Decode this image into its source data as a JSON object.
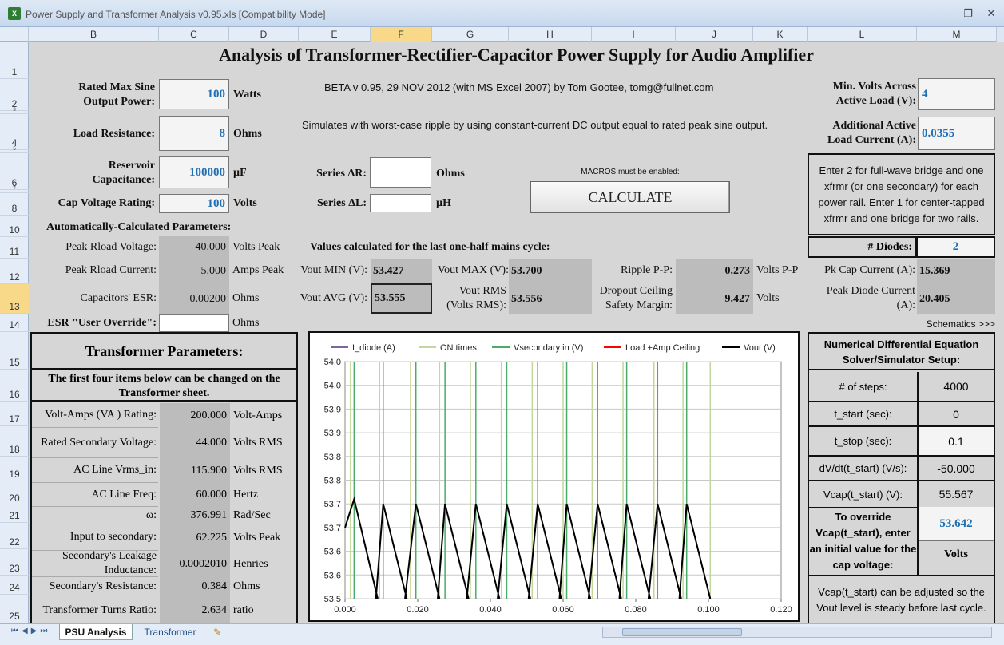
{
  "window": {
    "title": "Power Supply and Transformer Analysis v0.95.xls  [Compatibility Mode]",
    "icon": "excel-icon"
  },
  "columns": [
    "B",
    "C",
    "D",
    "E",
    "F",
    "G",
    "H",
    "I",
    "J",
    "K",
    "L",
    "M"
  ],
  "selected_column": "F",
  "rows": [
    "1",
    "2",
    "3",
    "4",
    "5",
    "6",
    "7",
    "8",
    "10",
    "11",
    "12",
    "13",
    "14",
    "15",
    "16",
    "17",
    "18",
    "19",
    "20",
    "21",
    "22",
    "23",
    "24",
    "25"
  ],
  "selected_row": "13",
  "sheet": {
    "title": "Analysis of Transformer-Rectifier-Capacitor Power Supply for Audio Amplifier",
    "beta": "BETA v 0.95, 29 NOV 2012 (with MS Excel 2007) by Tom Gootee, tomg@fullnet.com",
    "simulates": "Simulates with worst-case ripple by using constant-current DC output equal to rated peak sine output.",
    "macros_note": "MACROS must be enabled:",
    "calculate_label": "CALCULATE",
    "rated_power": {
      "label": "Rated Max Sine Output Power:",
      "value": "100",
      "unit": "Watts"
    },
    "load_resistance": {
      "label": "Load Resistance:",
      "value": "8",
      "unit": "Ohms"
    },
    "reservoir": {
      "label": "Reservoir Capacitance:",
      "value": "100000",
      "unit": "µF"
    },
    "cap_voltage": {
      "label": "Cap Voltage Rating:",
      "value": "100",
      "unit": "Volts"
    },
    "series_r": {
      "label": "Series ΔR:",
      "unit": "Ohms"
    },
    "series_l": {
      "label": "Series ΔL:",
      "unit": "µH"
    },
    "min_volts": {
      "label": "Min. Volts Across Active Load (V):",
      "value": "4"
    },
    "add_current": {
      "label": "Additional Active Load Current  (A):",
      "value": "0.0355"
    },
    "diode_note": "Enter 2 for full-wave bridge and one xfrmr (or one secondary) for each power rail. Enter 1 for center-tapped xfrmr and one bridge for two rails.",
    "diodes": {
      "label": "# Diodes:",
      "value": "2"
    },
    "auto_header": "Automatically-Calculated Parameters:",
    "peak_rload_v": {
      "label": "Peak Rload Voltage:",
      "value": "40.000",
      "unit": "Volts Peak"
    },
    "peak_rload_i": {
      "label": "Peak Rload Current:",
      "value": "5.000",
      "unit": "Amps Peak"
    },
    "esr": {
      "label": "Capacitors' ESR:",
      "value": "0.00200",
      "unit": "Ohms"
    },
    "esr_override": {
      "label": "ESR \"User Override\":",
      "unit": "Ohms"
    },
    "values_header": "Values calculated for the last one-half mains cycle:",
    "vout_min": {
      "label": "Vout MIN (V):",
      "value": "53.427"
    },
    "vout_max": {
      "label": "Vout MAX (V):",
      "value": "53.700"
    },
    "ripple": {
      "label": "Ripple P-P:",
      "value": "0.273",
      "unit": "Volts P-P"
    },
    "vout_avg": {
      "label": "Vout AVG (V):",
      "value": "53.555"
    },
    "vout_rms": {
      "label": "Vout RMS (Volts RMS):",
      "value": "53.556"
    },
    "dropout": {
      "label": "Dropout Ceiling Safety Margin:",
      "value": "9.427",
      "unit": "Volts"
    },
    "pk_cap": {
      "label": "Pk Cap Current (A):",
      "value": "15.369"
    },
    "peak_diode": {
      "label": "Peak Diode Current (A):",
      "value": "20.405"
    },
    "schematics": "Schematics >>>"
  },
  "transformer": {
    "title": "Transformer Parameters:",
    "note": "The first four items below can be changed  on the Transformer sheet.",
    "rows": [
      {
        "label": "Volt-Amps (VA ) Rating:",
        "value": "200.000",
        "unit": "Volt-Amps"
      },
      {
        "label": "Rated Secondary Voltage:",
        "value": "44.000",
        "unit": "Volts RMS"
      },
      {
        "label": "AC Line Vrms_in:",
        "value": "115.900",
        "unit": "Volts RMS"
      },
      {
        "label": "AC Line Freq:",
        "value": "60.000",
        "unit": "Hertz"
      },
      {
        "label": "ω:",
        "value": "376.991",
        "unit": "Rad/Sec"
      },
      {
        "label": "Input to secondary:",
        "value": "62.225",
        "unit": "Volts Peak"
      },
      {
        "label": "Secondary's Leakage Inductance:",
        "value": "0.0002010",
        "unit": "Henries"
      },
      {
        "label": "Secondary's Resistance:",
        "value": "0.384",
        "unit": "Ohms"
      },
      {
        "label": "Transformer Turns Ratio:",
        "value": "2.634",
        "unit": "ratio"
      }
    ]
  },
  "solver": {
    "title": "Numerical Differential Equation Solver/Simulator Setup:",
    "rows": [
      {
        "label": "# of steps:",
        "value": "4000"
      },
      {
        "label": "t_start (sec):",
        "value": "0"
      },
      {
        "label": "t_stop (sec):",
        "value": "0.1"
      },
      {
        "label": "dV/dt(t_start) (V/s):",
        "value": "-50.000"
      },
      {
        "label": "Vcap(t_start) (V):",
        "value": "55.567"
      }
    ],
    "override_label": "To override Vcap(t_start), enter an initial value for the cap voltage:",
    "override_value": "53.642",
    "override_unit": "Volts",
    "footer": "Vcap(t_start) can be adjusted so the Vout level is steady before last cycle."
  },
  "tabs": [
    "PSU Analysis",
    "Transformer"
  ],
  "colors": {
    "i_diode": "#8064a2",
    "on_times": "#c3d69b",
    "vsecondary": "#4bac6a",
    "load": "#ff0000",
    "vout": "#000000"
  },
  "chart_data": {
    "type": "line",
    "legend": [
      "I_diode (A)",
      "ON times",
      "Vsecondary in (V)",
      "Load +Amp Ceiling",
      "Vout (V)"
    ],
    "legend_position": "top",
    "xlim": [
      0,
      0.12
    ],
    "ylim": [
      53.5,
      54.0
    ],
    "xticks": [
      "0.000",
      "0.020",
      "0.040",
      "0.060",
      "0.080",
      "0.100",
      "0.120"
    ],
    "yticks": [
      "54.0",
      "54.0",
      "53.9",
      "53.9",
      "53.8",
      "53.8",
      "53.7",
      "53.7",
      "53.6",
      "53.6",
      "53.5"
    ],
    "vout_peaks": [
      {
        "x": 0.0025,
        "y": 53.71
      },
      {
        "x": 0.0105,
        "y": 53.7
      },
      {
        "x": 0.0195,
        "y": 53.7
      },
      {
        "x": 0.0275,
        "y": 53.7
      },
      {
        "x": 0.036,
        "y": 53.7
      },
      {
        "x": 0.0445,
        "y": 53.7
      },
      {
        "x": 0.053,
        "y": 53.7
      },
      {
        "x": 0.061,
        "y": 53.7
      },
      {
        "x": 0.0695,
        "y": 53.7
      },
      {
        "x": 0.0775,
        "y": 53.7
      },
      {
        "x": 0.086,
        "y": 53.7
      },
      {
        "x": 0.094,
        "y": 53.7
      }
    ],
    "vout_fall_end_x_offset": 0.0065,
    "on_times_x": [
      0.0015,
      0.0025,
      0.0095,
      0.0105,
      0.018,
      0.0195,
      0.026,
      0.0275,
      0.0345,
      0.036,
      0.043,
      0.0445,
      0.0515,
      0.053,
      0.06,
      0.061,
      0.068,
      0.0695,
      0.0765,
      0.0775,
      0.085,
      0.086,
      0.093,
      0.094,
      0.1005
    ]
  }
}
